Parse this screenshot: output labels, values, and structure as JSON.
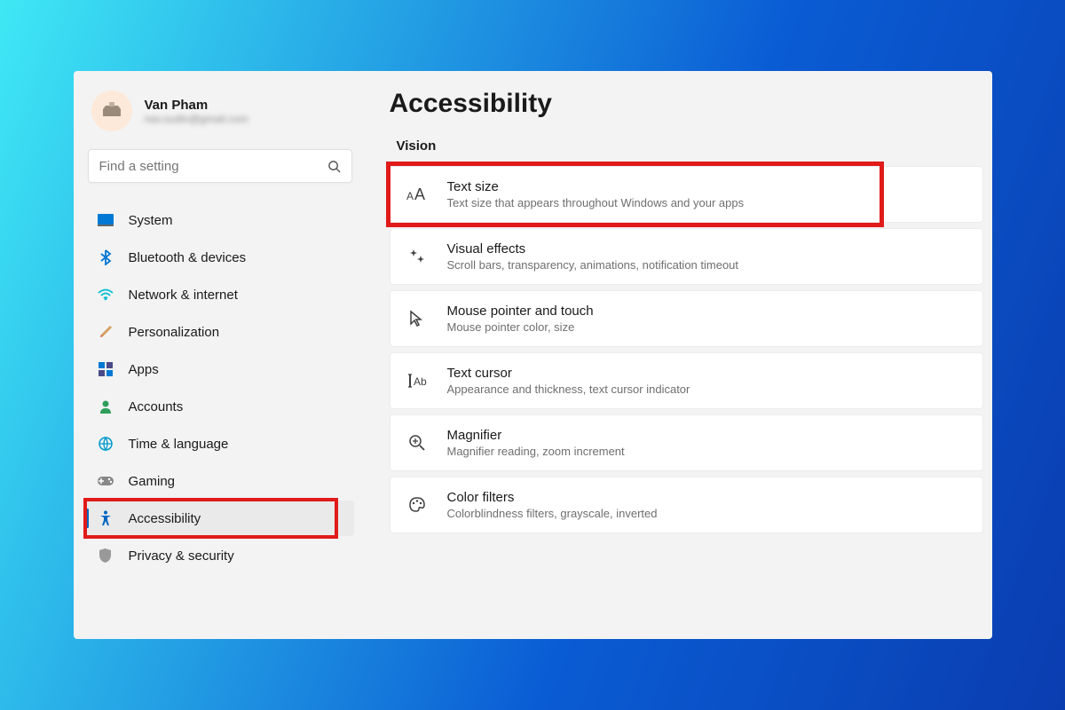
{
  "profile": {
    "name": "Van Pham",
    "email": "nav.sudin@gmail.com"
  },
  "search": {
    "placeholder": "Find a setting"
  },
  "sidebar": {
    "items": [
      {
        "label": "System",
        "icon": "system-icon"
      },
      {
        "label": "Bluetooth & devices",
        "icon": "bluetooth-icon"
      },
      {
        "label": "Network & internet",
        "icon": "wifi-icon"
      },
      {
        "label": "Personalization",
        "icon": "paintbrush-icon"
      },
      {
        "label": "Apps",
        "icon": "apps-icon"
      },
      {
        "label": "Accounts",
        "icon": "person-icon"
      },
      {
        "label": "Time & language",
        "icon": "globe-clock-icon"
      },
      {
        "label": "Gaming",
        "icon": "gamepad-icon"
      },
      {
        "label": "Accessibility",
        "icon": "accessibility-icon",
        "selected": true,
        "highlighted": true
      },
      {
        "label": "Privacy & security",
        "icon": "shield-icon"
      }
    ]
  },
  "main": {
    "title": "Accessibility",
    "section": "Vision",
    "cards": [
      {
        "title": "Text size",
        "desc": "Text size that appears throughout Windows and your apps",
        "icon": "text-size-icon",
        "highlighted": true
      },
      {
        "title": "Visual effects",
        "desc": "Scroll bars, transparency, animations, notification timeout",
        "icon": "sparkle-icon"
      },
      {
        "title": "Mouse pointer and touch",
        "desc": "Mouse pointer color, size",
        "icon": "cursor-icon"
      },
      {
        "title": "Text cursor",
        "desc": "Appearance and thickness, text cursor indicator",
        "icon": "text-cursor-icon"
      },
      {
        "title": "Magnifier",
        "desc": "Magnifier reading, zoom increment",
        "icon": "magnifier-icon"
      },
      {
        "title": "Color filters",
        "desc": "Colorblindness filters, grayscale, inverted",
        "icon": "palette-icon"
      }
    ]
  },
  "highlight_color": "#e11a1a"
}
